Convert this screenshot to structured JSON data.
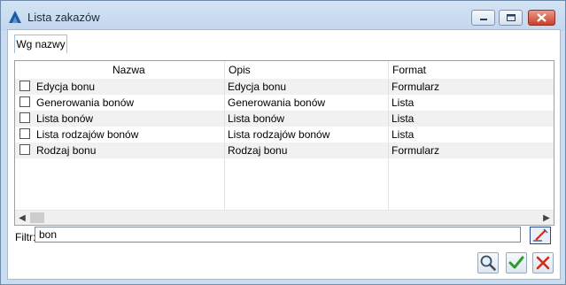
{
  "window": {
    "title": "Lista zakazów",
    "icon": "comarch-logo-icon",
    "controls": [
      "minimize-icon",
      "maximize-icon",
      "close-icon"
    ]
  },
  "tabs": [
    {
      "label": "Wg nazwy",
      "active": true
    }
  ],
  "table": {
    "columns": [
      "Nazwa",
      "Opis",
      "Format"
    ],
    "rows": [
      {
        "checked": false,
        "nazwa": "Edycja bonu",
        "opis": "Edycja bonu",
        "format": "Formularz"
      },
      {
        "checked": false,
        "nazwa": "Generowania bonów",
        "opis": "Generowania bonów",
        "format": "Lista"
      },
      {
        "checked": false,
        "nazwa": "Lista bonów",
        "opis": "Lista bonów",
        "format": "Lista"
      },
      {
        "checked": false,
        "nazwa": "Lista rodzajów bonów",
        "opis": "Lista rodzajów bonów",
        "format": "Lista"
      },
      {
        "checked": false,
        "nazwa": "Rodzaj bonu",
        "opis": "Rodzaj bonu",
        "format": "Formularz"
      }
    ]
  },
  "filter": {
    "label": "Filtr:",
    "value": "bon"
  },
  "actions": {
    "search_icon": "magnifier-icon",
    "confirm_icon": "checkmark-icon",
    "cancel_icon": "cross-icon",
    "clear_icon": "clear-filter-icon"
  },
  "colors": {
    "window_frame": "#c9dcf0",
    "confirm_green": "#2e9a2e",
    "cancel_red": "#d42a1a",
    "alt_row": "#f1f1f1"
  }
}
